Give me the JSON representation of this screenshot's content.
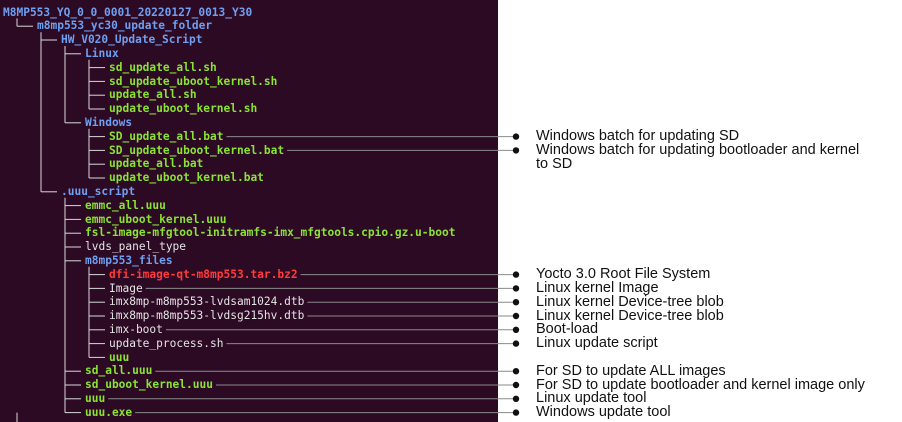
{
  "tree": [
    {
      "text": "M8MP553_YQ_0_0_0001_20220127_0013_Y30",
      "kind": "dir",
      "depth": 0,
      "last": false
    },
    {
      "text": "m8mp553_yc30_update_folder",
      "kind": "dir",
      "depth": 1,
      "last": false
    },
    {
      "text": "HW_V020_Update_Script",
      "kind": "dir",
      "depth": 2,
      "last": false
    },
    {
      "text": "Linux",
      "kind": "dir",
      "depth": 3,
      "last": false
    },
    {
      "text": "sd_update_all.sh",
      "kind": "exec",
      "depth": 4,
      "last": false
    },
    {
      "text": "sd_update_uboot_kernel.sh",
      "kind": "exec",
      "depth": 4,
      "last": false
    },
    {
      "text": "update_all.sh",
      "kind": "exec",
      "depth": 4,
      "last": false
    },
    {
      "text": "update_uboot_kernel.sh",
      "kind": "exec",
      "depth": 4,
      "last": true
    },
    {
      "text": "Windows",
      "kind": "dir",
      "depth": 3,
      "last": true
    },
    {
      "text": "SD_update_all.bat",
      "kind": "exec",
      "depth": 4,
      "last": false
    },
    {
      "text": "SD_update_uboot_kernel.bat",
      "kind": "exec",
      "depth": 4,
      "last": false
    },
    {
      "text": "update_all.bat",
      "kind": "exec",
      "depth": 4,
      "last": false
    },
    {
      "text": "update_uboot_kernel.bat",
      "kind": "exec",
      "depth": 4,
      "last": true
    },
    {
      "text": ".uuu_script",
      "kind": "dir",
      "depth": 2,
      "last": true
    },
    {
      "text": "emmc_all.uuu",
      "kind": "exec",
      "depth": 3,
      "last": false
    },
    {
      "text": "emmc_uboot_kernel.uuu",
      "kind": "exec",
      "depth": 3,
      "last": false
    },
    {
      "text": "fsl-image-mfgtool-initramfs-imx_mfgtools.cpio.gz.u-boot",
      "kind": "exec",
      "depth": 3,
      "last": false
    },
    {
      "text": "lvds_panel_type",
      "kind": "plain",
      "depth": 3,
      "last": false
    },
    {
      "text": "m8mp553_files",
      "kind": "dir",
      "depth": 3,
      "last": false
    },
    {
      "text": "dfi-image-qt-m8mp553.tar.bz2",
      "kind": "archive",
      "depth": 4,
      "last": false
    },
    {
      "text": "Image",
      "kind": "plain",
      "depth": 4,
      "last": false
    },
    {
      "text": "imx8mp-m8mp553-lvdsam1024.dtb",
      "kind": "plain",
      "depth": 4,
      "last": false
    },
    {
      "text": "imx8mp-m8mp553-lvdsg215hv.dtb",
      "kind": "plain",
      "depth": 4,
      "last": false
    },
    {
      "text": "imx-boot",
      "kind": "plain",
      "depth": 4,
      "last": false
    },
    {
      "text": "update_process.sh",
      "kind": "plain",
      "depth": 4,
      "last": false
    },
    {
      "text": "uuu",
      "kind": "exec",
      "depth": 4,
      "last": true
    },
    {
      "text": "sd_all.uuu",
      "kind": "exec",
      "depth": 3,
      "last": false
    },
    {
      "text": "sd_uboot_kernel.uuu",
      "kind": "exec",
      "depth": 3,
      "last": false
    },
    {
      "text": "uuu",
      "kind": "exec",
      "depth": 3,
      "last": false
    },
    {
      "text": "uuu.exe",
      "kind": "exec",
      "depth": 3,
      "last": true
    }
  ],
  "annotations": [
    {
      "row": 9,
      "lines": [
        "Windows batch for updating SD"
      ]
    },
    {
      "row": 10,
      "lines": [
        "Windows batch for updating bootloader and kernel",
        "to SD"
      ]
    },
    {
      "row": 19,
      "lines": [
        "Yocto 3.0 Root File System"
      ]
    },
    {
      "row": 20,
      "lines": [
        "Linux kernel Image"
      ]
    },
    {
      "row": 21,
      "lines": [
        "Linux kernel Device-tree blob"
      ]
    },
    {
      "row": 22,
      "lines": [
        "Linux kernel Device-tree blob"
      ]
    },
    {
      "row": 23,
      "lines": [
        "Boot-load"
      ]
    },
    {
      "row": 24,
      "lines": [
        "Linux update script"
      ]
    },
    {
      "row": 26,
      "lines": [
        "For SD to update ALL images"
      ]
    },
    {
      "row": 27,
      "lines": [
        "For SD to update bootloader and kernel image only"
      ]
    },
    {
      "row": 28,
      "lines": [
        "Linux update tool"
      ]
    },
    {
      "row": 29,
      "lines": [
        "Windows update tool"
      ]
    }
  ],
  "colors": {
    "terminal_bg": "#2d0a24",
    "directory": "#6f9ff0",
    "executable": "#8ae234",
    "archive": "#ff3b3b",
    "plain_file": "#e4e4e4",
    "leader_line": "#8a8a8a",
    "annotation_text": "#111111"
  }
}
